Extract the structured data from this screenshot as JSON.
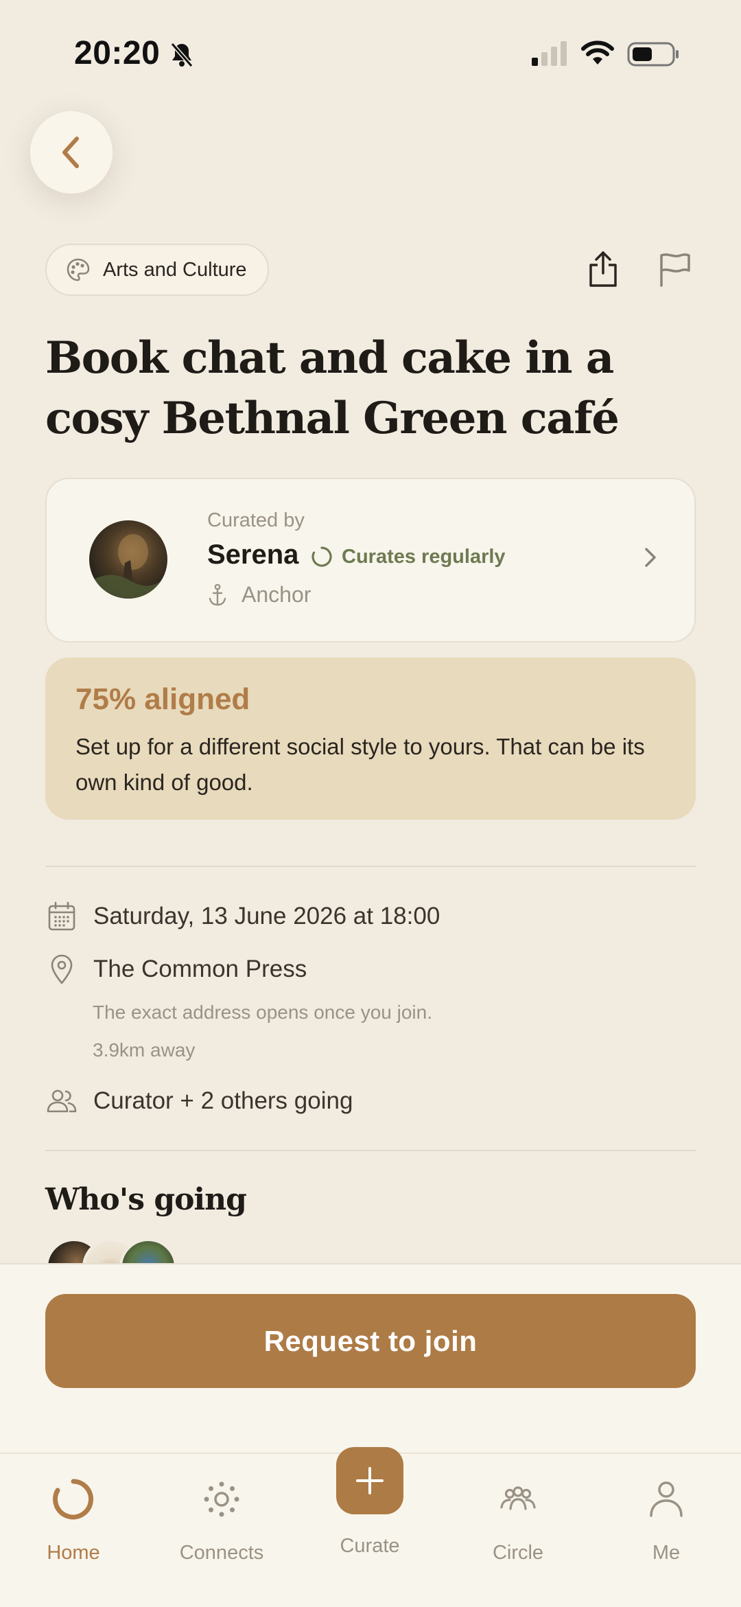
{
  "status_bar": {
    "time": "20:20"
  },
  "category": {
    "label": "Arts and Culture"
  },
  "event": {
    "title": "Book chat and cake in a cosy Bethnal Green café"
  },
  "curator": {
    "caption": "Curated by",
    "name": "Serena",
    "badge": "Curates regularly",
    "role": "Anchor"
  },
  "alignment": {
    "title": "75% aligned",
    "text": "Set up for a different social style to yours. That can be its own kind of good."
  },
  "details": {
    "datetime": "Saturday, 13 June 2026 at 18:00",
    "venue": "The Common Press",
    "address_note": "The exact address opens once you join.",
    "distance": "3.9km away",
    "attendance": "Curator + 2 others going"
  },
  "attendees_section": {
    "title": "Who's going"
  },
  "cta": {
    "label": "Request to join"
  },
  "tabs": [
    {
      "label": "Home"
    },
    {
      "label": "Connects"
    },
    {
      "label": "Curate"
    },
    {
      "label": "Circle"
    },
    {
      "label": "Me"
    }
  ],
  "colors": {
    "accent": "#ad7b45",
    "background": "#f1ebe0",
    "olive": "#6e7a52"
  }
}
